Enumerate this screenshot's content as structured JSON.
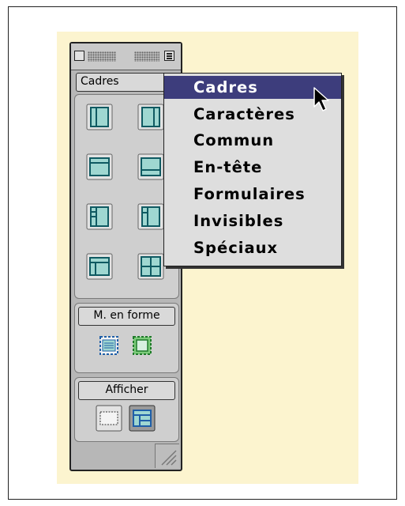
{
  "palette": {
    "category": "Cadres",
    "sections": {
      "mise_en_forme": "M. en forme",
      "afficher": "Afficher"
    },
    "icons": [
      "frame-left-icon",
      "frame-right-icon",
      "frame-top-icon",
      "frame-bottom-icon",
      "frame-left-top-icon",
      "frame-left-bottom-icon",
      "frame-top-left-icon",
      "frame-grid-icon",
      "layout-table-icon",
      "layout-frame-icon",
      "standard-view-icon",
      "layout-view-icon"
    ]
  },
  "menu": {
    "items": [
      "Cadres",
      "Caractères",
      "Commun",
      "En-tête",
      "Formulaires",
      "Invisibles",
      "Spéciaux"
    ],
    "selected": "Cadres"
  },
  "colors": {
    "background": "#fcf4cf",
    "selection": "#3d3d7c",
    "icon_fill": "#9fd7d1",
    "icon_stroke": "#0f5a62"
  }
}
